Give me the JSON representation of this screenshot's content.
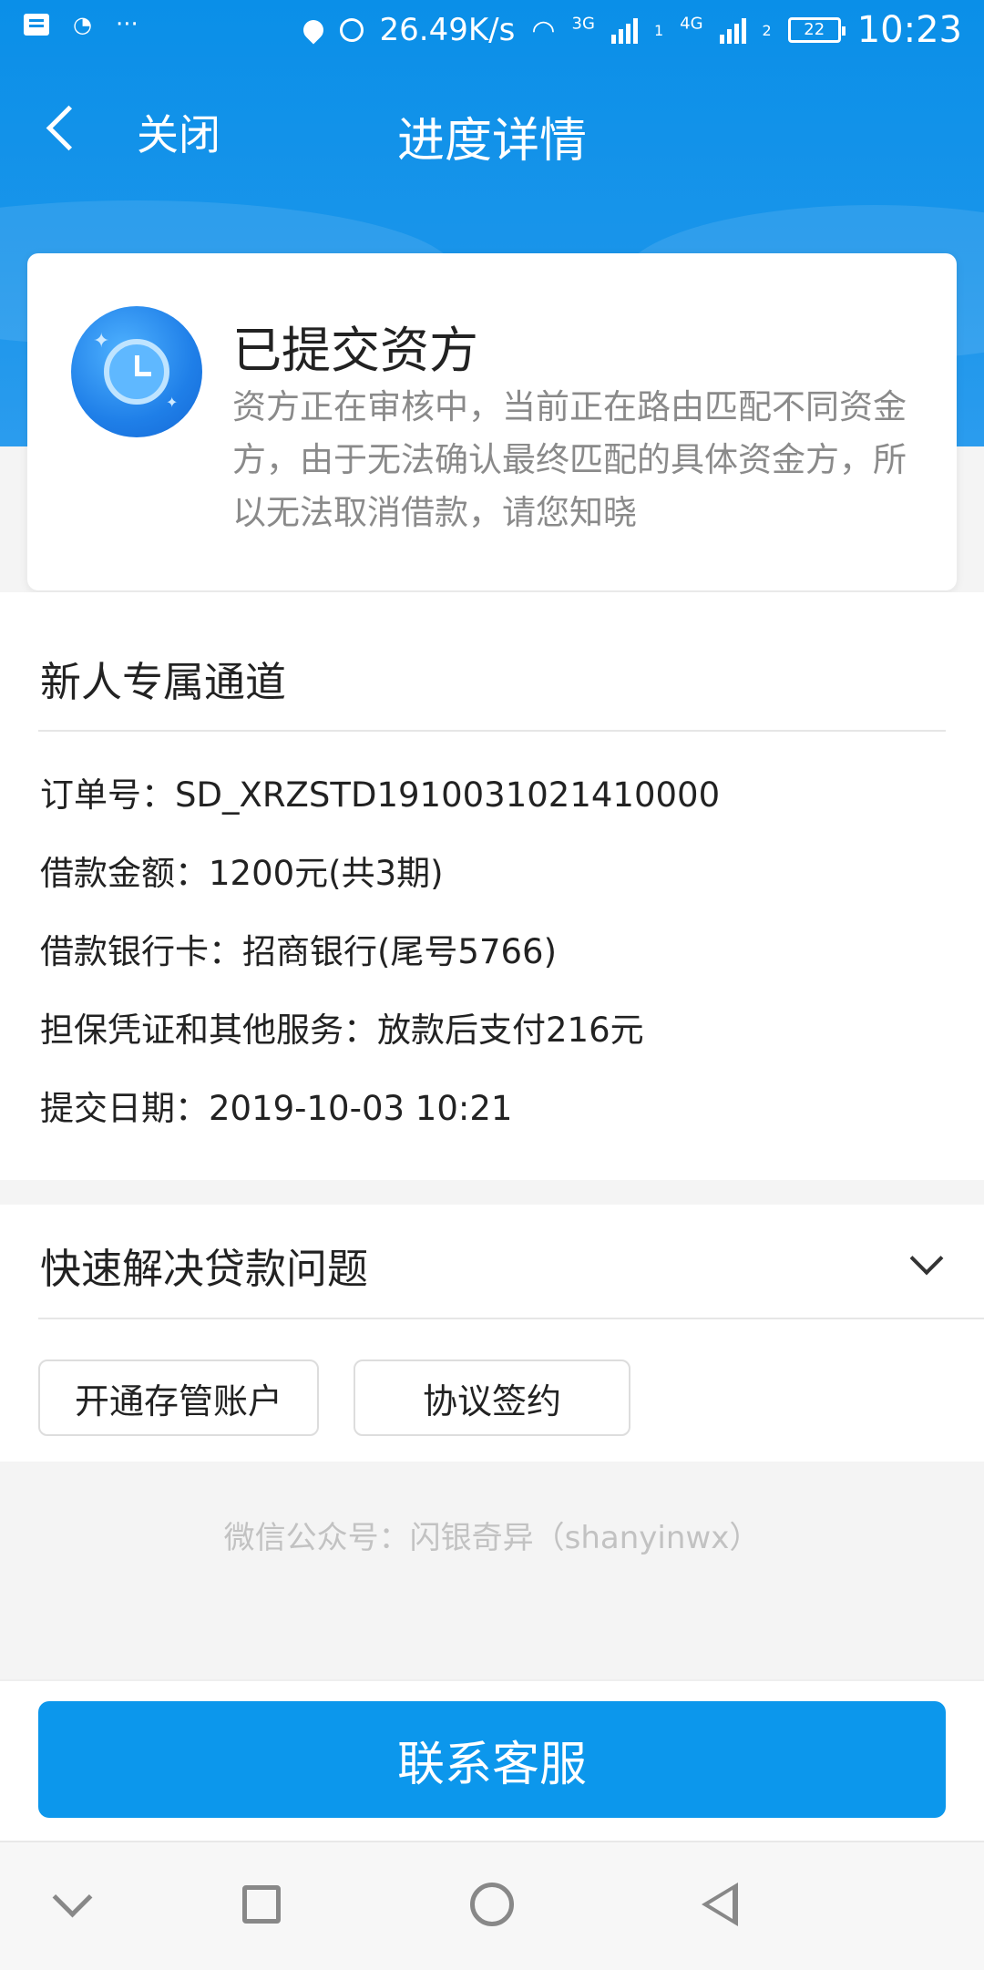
{
  "statusbar": {
    "speed": "26.49K/s",
    "net1": "3G",
    "net2": "4G",
    "sim1": "1",
    "sim2": "2",
    "battery": "22",
    "time": "10:23"
  },
  "nav": {
    "close_label": "关闭",
    "title": "进度详情"
  },
  "status_card": {
    "title": "已提交资方",
    "description": "资方正在审核中，当前正在路由匹配不同资金方，由于无法确认最终匹配的具体资金方，所以无法取消借款，请您知晓"
  },
  "order": {
    "channel_title": "新人专属通道",
    "rows": [
      "订单号：SD_XRZSTD1910031021410000",
      "借款金额：1200元(共3期)",
      "借款银行卡：招商银行(尾号5766)",
      "担保凭证和其他服务：放款后支付216元",
      "提交日期：2019-10-03 10:21"
    ]
  },
  "help": {
    "title": "快速解决贷款问题",
    "buttons": [
      "开通存管账户",
      "协议签约"
    ]
  },
  "footer": {
    "note": "微信公众号：闪银奇异（shanyinwx）"
  },
  "contact": {
    "label": "联系客服"
  },
  "colors": {
    "primary": "#0c97ec",
    "header": "#0a8fe8",
    "muted_text": "#8a8a8a"
  }
}
